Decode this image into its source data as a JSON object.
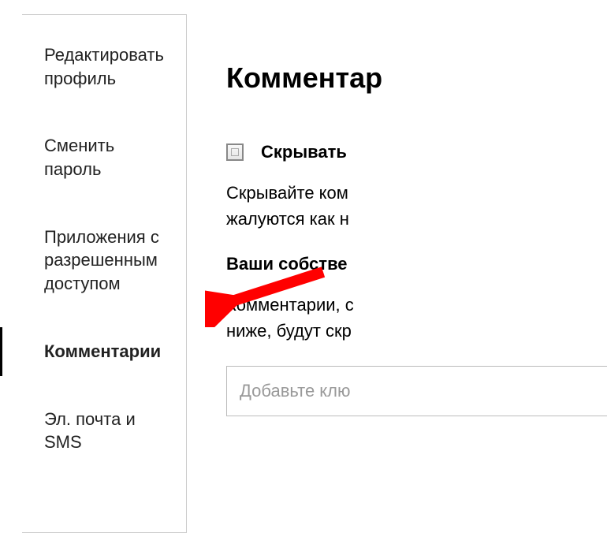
{
  "sidebar": {
    "items": [
      {
        "label": "Редактировать профиль",
        "active": false
      },
      {
        "label": "Сменить пароль",
        "active": false
      },
      {
        "label": "Приложения с разрешенным доступом",
        "active": false
      },
      {
        "label": "Комментарии",
        "active": true
      },
      {
        "label": "Эл. почта и SMS",
        "active": false
      }
    ]
  },
  "main": {
    "heading": "Комментар",
    "checkbox_label": "Скрывать",
    "help_text_line1": "Скрывайте ком",
    "help_text_line2": "жалуются как н",
    "subheading": "Ваши собстве",
    "body_line1": "Комментарии, с",
    "body_line2": "ниже, будут скр",
    "input_placeholder": "Добавьте клю"
  }
}
